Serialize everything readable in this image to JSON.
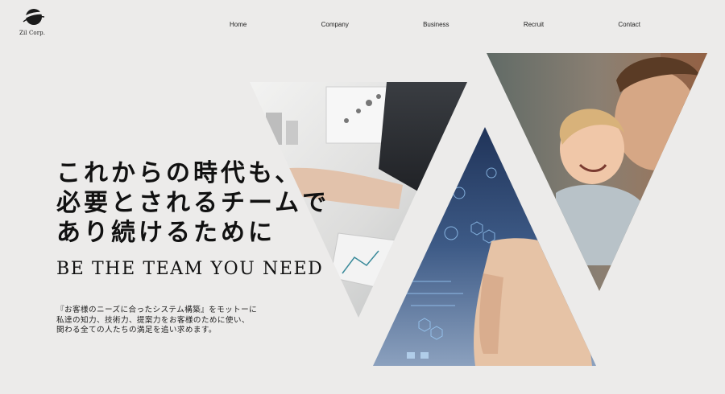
{
  "brand": {
    "name": "Zil Corp."
  },
  "nav": {
    "items": [
      "Home",
      "Company",
      "Business",
      "Recruit",
      "Contact"
    ]
  },
  "hero": {
    "headline_lines": [
      "これからの時代も、",
      "必要とされるチームで",
      "あり続けるために"
    ],
    "tagline": "BE THE TEAM YOU NEED",
    "description_lines": [
      "『お客様のニーズに合ったシステム構築』をモットーに",
      "私達の知力、技術力、提案力をお客様のために使い、",
      "関わる全ての人たちの満足を追い求めます。"
    ],
    "images": [
      {
        "name": "meeting-photo",
        "description": "business meeting with hand over documents"
      },
      {
        "name": "tech-photo",
        "description": "finger touching digital interface"
      },
      {
        "name": "family-photo",
        "description": "smiling child with father"
      }
    ]
  },
  "colors": {
    "background": "#ecebea",
    "text": "#111111",
    "tech_blue": "#2a4470"
  }
}
